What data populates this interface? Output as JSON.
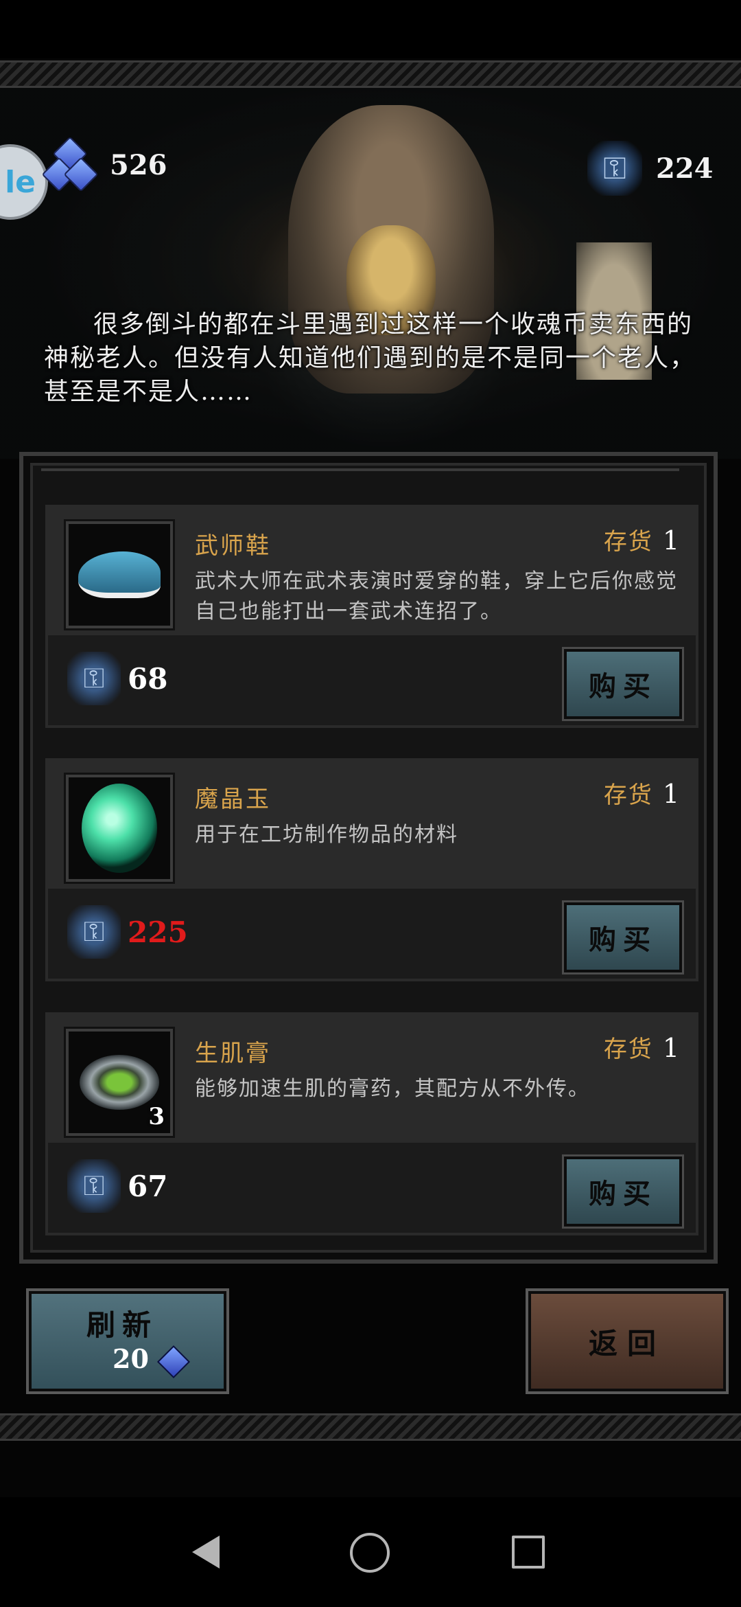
{
  "header": {
    "gem_count": "526",
    "soul_coin_count": "224",
    "side_tab_label": "le"
  },
  "intro_text": "很多倒斗的都在斗里遇到过这样一个收魂币卖东西的神秘老人。但没有人知道他们遇到的是不是同一个老人，甚至是不是人……",
  "items": [
    {
      "name": "武师鞋",
      "stock_label": "存货",
      "stock": "1",
      "description": "武术大师在武术表演时爱穿的鞋，穿上它后你感觉自己也能打出一套武术连招了。",
      "price": "68",
      "buy_label": "购买",
      "thumb_badge": ""
    },
    {
      "name": "魔晶玉",
      "stock_label": "存货",
      "stock": "1",
      "description": "用于在工坊制作物品的材料",
      "price": "225",
      "buy_label": "购买",
      "thumb_badge": ""
    },
    {
      "name": "生肌膏",
      "stock_label": "存货",
      "stock": "1",
      "description": "能够加速生肌的膏药，其配方从不外传。",
      "price": "67",
      "buy_label": "购买",
      "thumb_badge": "3"
    }
  ],
  "footer": {
    "refresh_label": "刷新",
    "refresh_cost": "20",
    "back_label": "返回"
  },
  "colors": {
    "accent_gold": "#d9a44c",
    "unaffordable_price": "#e01b1b"
  },
  "icons": {
    "soul_coin": "soul-coin-icon",
    "gem": "gem-icon"
  }
}
